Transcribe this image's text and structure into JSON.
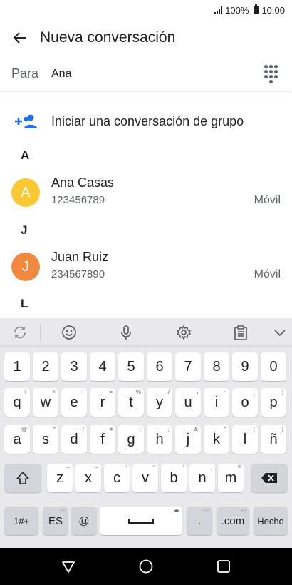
{
  "status_bar": {
    "battery": "100%",
    "time": "10:00"
  },
  "app_bar": {
    "title": "Nueva conversación"
  },
  "recipient": {
    "label": "Para",
    "value": "Ana"
  },
  "group_action": {
    "label": "Iniciar una conversación de grupo"
  },
  "sections": [
    {
      "letter": "A"
    },
    {
      "letter": "J"
    },
    {
      "letter": "L"
    }
  ],
  "contacts": [
    {
      "initial": "A",
      "name": "Ana Casas",
      "number": "123456789",
      "type": "Móvil",
      "color": "#f9c832"
    },
    {
      "initial": "J",
      "name": "Juan Ruiz",
      "number": "234567890",
      "type": "Móvil",
      "color": "#f0883f"
    }
  ],
  "colors": {
    "accent": "#1a73e8"
  },
  "keyboard": {
    "number_row": [
      "1",
      "2",
      "3",
      "4",
      "5",
      "6",
      "7",
      "8",
      "9",
      "0"
    ],
    "row1": [
      {
        "k": "q",
        "s": "+"
      },
      {
        "k": "w",
        "s": "×"
      },
      {
        "k": "e",
        "s": "÷"
      },
      {
        "k": "r",
        "s": "="
      },
      {
        "k": "t",
        "s": "%"
      },
      {
        "k": "y",
        "s": "/"
      },
      {
        "k": "u",
        "s": "\\"
      },
      {
        "k": "i",
        "s": "~"
      },
      {
        "k": "o",
        "s": "["
      },
      {
        "k": "p",
        "s": "]"
      }
    ],
    "row2": [
      {
        "k": "a",
        "s": "@"
      },
      {
        "k": "s",
        "s": "*"
      },
      {
        "k": "d",
        "s": "!"
      },
      {
        "k": "f",
        "s": "#"
      },
      {
        "k": "g",
        "s": ":"
      },
      {
        "k": "h",
        "s": ";"
      },
      {
        "k": "j",
        "s": "&"
      },
      {
        "k": "k",
        "s": "^"
      },
      {
        "k": "l",
        "s": "("
      },
      {
        "k": "ñ",
        "s": ")"
      }
    ],
    "row3": [
      {
        "k": "z",
        "s": "–"
      },
      {
        "k": "x",
        "s": "–"
      },
      {
        "k": "c",
        "s": "'"
      },
      {
        "k": "v",
        "s": "\""
      },
      {
        "k": "b",
        "s": "'"
      },
      {
        "k": "n",
        "s": ","
      },
      {
        "k": "m",
        "s": "?"
      }
    ],
    "symbols_key": "1#+",
    "lang_key": "ES",
    "at_key": "@",
    "period_key": ".",
    "com_key": ".com",
    "done_key": "Hecho"
  }
}
